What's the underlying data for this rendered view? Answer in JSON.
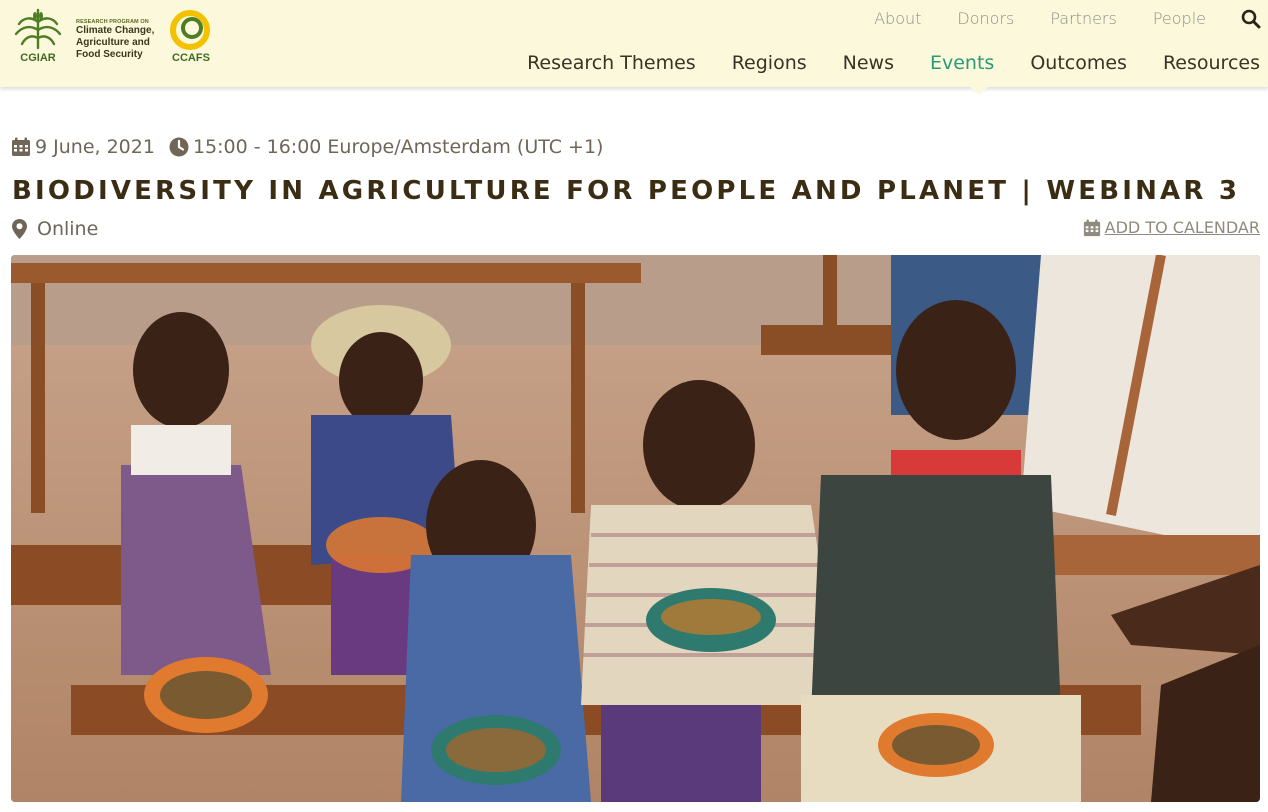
{
  "header": {
    "cgiar_logo_text": "CGIAR",
    "program_small": "RESEARCH PROGRAM ON",
    "program_lines": [
      "Climate Change,",
      "Agriculture and",
      "Food Security"
    ],
    "ccafs_logo_text": "CCAFS",
    "top_links": [
      "About",
      "Donors",
      "Partners",
      "People"
    ],
    "main_nav": [
      "Research Themes",
      "Regions",
      "News",
      "Events",
      "Outcomes",
      "Resources"
    ],
    "active_nav": "Events"
  },
  "event": {
    "date": "9 June, 2021",
    "time": "15:00 - 16:00 Europe/Amsterdam (UTC +1)",
    "title": "BIODIVERSITY IN AGRICULTURE FOR PEOPLE AND PLANET | WEBINAR 3",
    "location": "Online",
    "add_to_calendar": "ADD TO CALENDAR"
  },
  "colors": {
    "header_bg": "#fbf8dc",
    "active_nav": "#2a9a74",
    "title": "#3a2d14",
    "meta_text": "#6f6658"
  },
  "icons": {
    "date": "calendar-icon",
    "time": "clock-icon",
    "location": "map-marker-icon",
    "calendar_link": "calendar-icon",
    "search": "search-icon"
  }
}
